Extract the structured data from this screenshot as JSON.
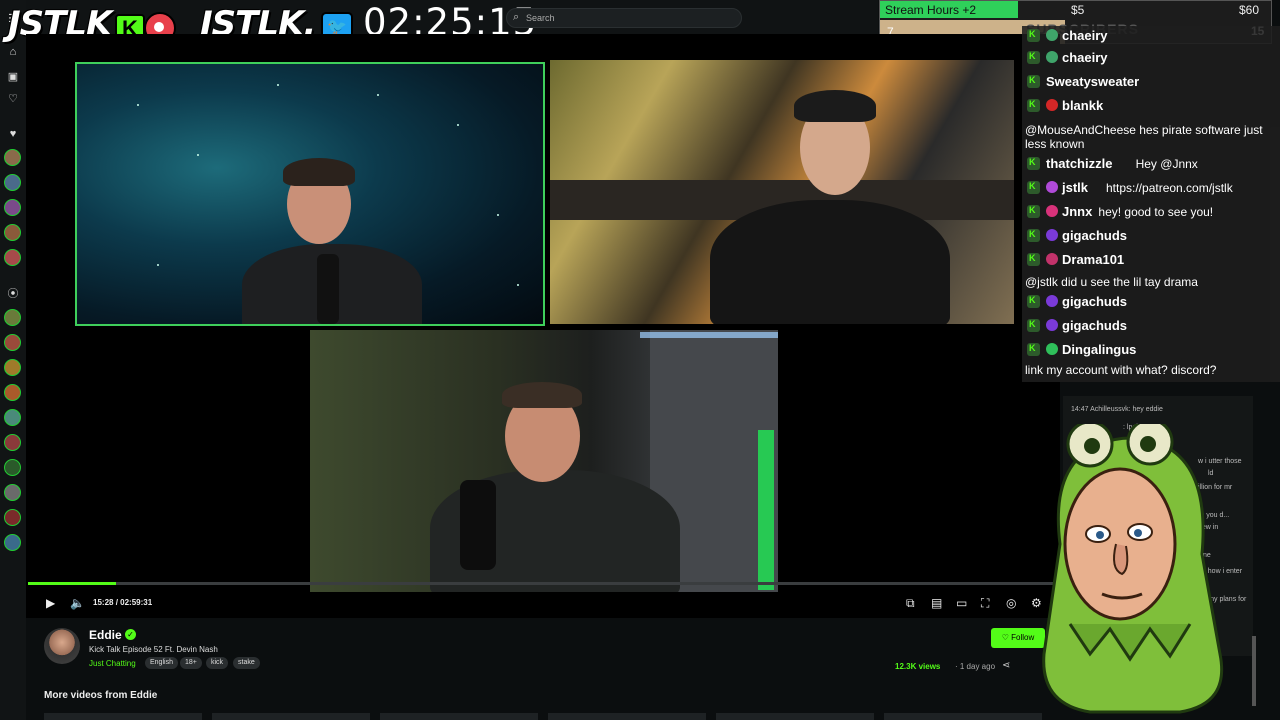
{
  "overlay": {
    "logo1": "JSTLK",
    "logo1_k": "K",
    "logo2": "JSTLK.",
    "timer": "02:25:15"
  },
  "search": {
    "placeholder": "Search"
  },
  "goal": {
    "label": "Stream Hours +2",
    "min_price": "$5",
    "max_price": "$60",
    "current": "7",
    "target": "15",
    "subs_label": "SUBSCRIBERS",
    "progress_fraction": 0.47
  },
  "player": {
    "time_current": "15:28",
    "time_sep": " / ",
    "time_total": "02:59:31",
    "progress_fraction": 0.085
  },
  "video": {
    "channel": "Eddie",
    "title": "Kick Talk Episode 52 Ft. Devin Nash",
    "category": "Just Chatting",
    "tags": [
      "English",
      "18+",
      "kick",
      "stake"
    ],
    "follow_label": "Follow",
    "views": "12.3K views",
    "ago": "· 1 day ago"
  },
  "more_videos_label": "More videos from Eddie",
  "chat": [
    {
      "user": "chaeiry",
      "color": "#5ad19a",
      "msg": "",
      "dot": "#3fa46a",
      "type": "inline",
      "top": "partial"
    },
    {
      "user": "chaeiry",
      "color": "#5ad19a",
      "msg": "",
      "dot": "#3fa46a",
      "type": "inline"
    },
    {
      "user": "Sweatysweater",
      "color": "#fff",
      "msg": "",
      "dot": "",
      "type": "inline"
    },
    {
      "user": "blankk",
      "color": "#fff",
      "msg": "",
      "dot": "#d42727",
      "type": "inline"
    },
    {
      "user": "",
      "msg": "@MouseAndCheese hes pirate software just less known",
      "type": "full"
    },
    {
      "user": "thatchizzle",
      "msg": "Hey @Jnnx",
      "dot": "",
      "type": "inline"
    },
    {
      "user": "jstlk",
      "msg": "https://patreon.com/jstlk",
      "dot": "#b04ad8",
      "type": "inline"
    },
    {
      "user": "Jnnx",
      "msg": "hey! good to see you!",
      "dot": "#d8327a",
      "type": "inline"
    },
    {
      "user": "gigachuds",
      "msg": "",
      "dot": "#7a3ad8",
      "type": "inline"
    },
    {
      "user": "Drama101",
      "msg": "",
      "dot": "#c2326a",
      "type": "inline"
    },
    {
      "user": "",
      "msg": "@jstlk did u see the lil tay drama",
      "type": "full"
    },
    {
      "user": "gigachuds",
      "msg": "",
      "dot": "#7a3ad8",
      "type": "inline"
    },
    {
      "user": "gigachuds",
      "msg": "",
      "dot": "#7a3ad8",
      "type": "inline"
    },
    {
      "user": "Dingalingus",
      "msg": "",
      "dot": "#2fbf5a",
      "type": "inline"
    },
    {
      "user": "",
      "msg": "link my account with what? discord?",
      "type": "full"
    }
  ],
  "chat2": [
    {
      "text": "14:47 Achilleussvk: hey eddie"
    },
    {
      "text": ": lpol"
    },
    {
      "text": "w i utter those"
    },
    {
      "text": "ld"
    },
    {
      "text": "illion for mr"
    },
    {
      "text": "can you d..."
    },
    {
      "text": "new in"
    },
    {
      "text": "ne"
    },
    {
      "text": "how how i enter"
    },
    {
      "text": "ave any plans for"
    },
    {
      "text": "m"
    }
  ],
  "colors": {
    "kick_green": "#53fc18",
    "goal_green": "#2fd05a"
  }
}
